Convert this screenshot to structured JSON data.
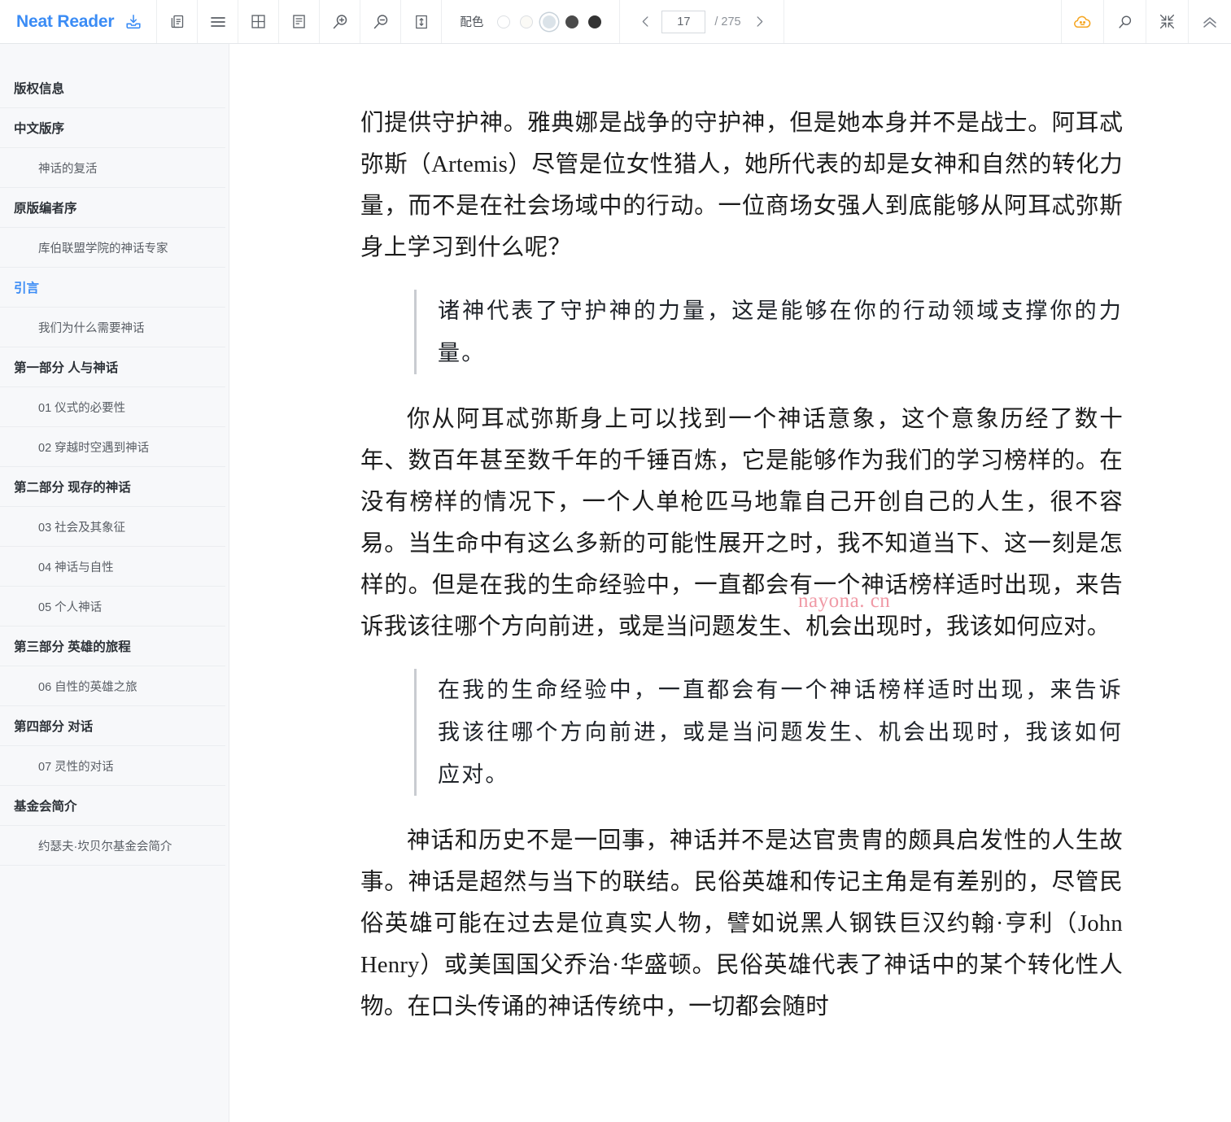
{
  "app": {
    "brand": "Neat Reader",
    "brand_color": "#3b8cf5"
  },
  "toolbar": {
    "save_icon": "save-to-tray-icon",
    "duplicate_icon": "duplicate-pages-icon",
    "menu_icon": "hamburger-menu-icon",
    "grid_icon": "grid-layout-icon",
    "text_layout_icon": "text-layout-icon",
    "zoom_in_icon": "zoom-in-icon",
    "zoom_out_icon": "zoom-out-icon",
    "line_height_icon": "line-height-icon",
    "colors_label": "配色",
    "swatches": [
      {
        "name": "swatch-white",
        "color": "#ffffff",
        "selected": false
      },
      {
        "name": "swatch-cream",
        "color": "#fbfaf6",
        "selected": false
      },
      {
        "name": "swatch-bluegray",
        "color": "#dbe3e9",
        "selected": true
      },
      {
        "name": "swatch-darkgray",
        "color": "#4b4b4b",
        "selected": false
      },
      {
        "name": "swatch-black",
        "color": "#333333",
        "selected": false
      }
    ],
    "pager": {
      "prev_icon": "chevron-left-icon",
      "next_icon": "chevron-right-icon",
      "current_page": "17",
      "total_label": "/ 275"
    },
    "cloud_icon": "cloud-sync-icon",
    "cloud_color": "#f5a623",
    "search_icon": "search-icon",
    "collapse_icon": "collapse-fullscreen-icon",
    "chevron_up_icon": "chevron-up-icon"
  },
  "sidebar": {
    "items": [
      {
        "label": "版权信息",
        "level": 1,
        "active": false
      },
      {
        "label": "中文版序",
        "level": 1,
        "active": false
      },
      {
        "label": "神话的复活",
        "level": 2,
        "active": false
      },
      {
        "label": "原版编者序",
        "level": 1,
        "active": false
      },
      {
        "label": "库伯联盟学院的神话专家",
        "level": 2,
        "active": false
      },
      {
        "label": "引言",
        "level": 1,
        "active": true
      },
      {
        "label": "我们为什么需要神话",
        "level": 2,
        "active": false
      },
      {
        "label": "第一部分 人与神话",
        "level": 1,
        "active": false
      },
      {
        "label": "01 仪式的必要性",
        "level": 2,
        "active": false
      },
      {
        "label": "02 穿越时空遇到神话",
        "level": 2,
        "active": false
      },
      {
        "label": "第二部分 现存的神话",
        "level": 1,
        "active": false
      },
      {
        "label": "03 社会及其象征",
        "level": 2,
        "active": false
      },
      {
        "label": "04 神话与自性",
        "level": 2,
        "active": false
      },
      {
        "label": "05 个人神话",
        "level": 2,
        "active": false
      },
      {
        "label": "第三部分 英雄的旅程",
        "level": 1,
        "active": false
      },
      {
        "label": "06 自性的英雄之旅",
        "level": 2,
        "active": false
      },
      {
        "label": "第四部分 对话",
        "level": 1,
        "active": false
      },
      {
        "label": "07 灵性的对话",
        "level": 2,
        "active": false
      },
      {
        "label": "基金会简介",
        "level": 1,
        "active": false
      },
      {
        "label": "约瑟夫·坎贝尔基金会简介",
        "level": 2,
        "active": false
      }
    ]
  },
  "content": {
    "paragraph_1": "们提供守护神。雅典娜是战争的守护神，但是她本身并不是战士。阿耳忒弥斯（Artemis）尽管是位女性猎人，她所代表的却是女神和自然的转化力量，而不是在社会场域中的行动。一位商场女强人到底能够从阿耳忒弥斯身上学习到什么呢？",
    "quote_1": "诸神代表了守护神的力量，这是能够在你的行动领域支撑你的力量。",
    "paragraph_2": "你从阿耳忒弥斯身上可以找到一个神话意象，这个意象历经了数十年、数百年甚至数千年的千锤百炼，它是能够作为我们的学习榜样的。在没有榜样的情况下，一个人单枪匹马地靠自己开创自己的人生，很不容易。当生命中有这么多新的可能性展开之时，我不知道当下、这一刻是怎样的。但是在我的生命经验中，一直都会有一个神话榜样适时出现，来告诉我该往哪个方向前进，或是当问题发生、机会出现时，我该如何应对。",
    "quote_2": "在我的生命经验中，一直都会有一个神话榜样适时出现，来告诉我该往哪个方向前进，或是当问题发生、机会出现时，我该如何应对。",
    "paragraph_3": "神话和历史不是一回事，神话并不是达官贵胄的颇具启发性的人生故事。神话是超然与当下的联结。民俗英雄和传记主角是有差别的，尽管民俗英雄可能在过去是位真实人物，譬如说黑人钢铁巨汉约翰·亨利（John Henry）或美国国父乔治·华盛顿。民俗英雄代表了神话中的某个转化性人物。在口头传诵的神话传统中，一切都会随时",
    "watermark": "nayona. cn"
  }
}
